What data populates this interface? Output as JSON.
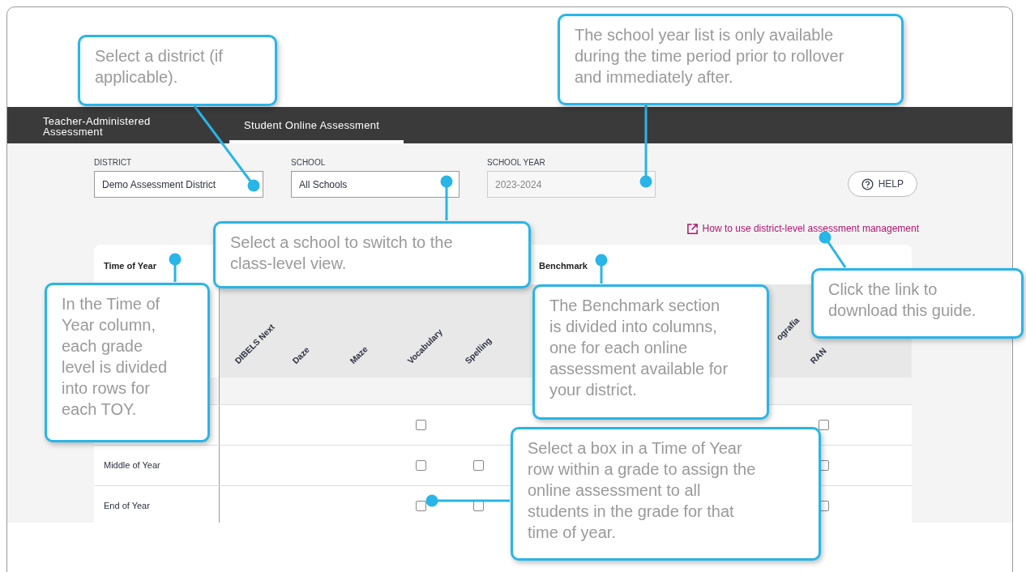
{
  "tabs": [
    {
      "label": "Teacher-Administered Assessment",
      "selected": false
    },
    {
      "label": "Student Online Assessment",
      "selected": true
    }
  ],
  "filters": [
    {
      "label": "DISTRICT",
      "value": "Demo Assessment District",
      "disabled": false
    },
    {
      "label": "SCHOOL",
      "value": "All Schools",
      "disabled": false
    },
    {
      "label": "SCHOOL YEAR",
      "value": "2023-2024",
      "disabled": true
    }
  ],
  "help_button": {
    "label": "HELP"
  },
  "guide_link": "How to use district-level assessment management",
  "table": {
    "time_heading": "Time of Year",
    "benchmark_heading": "Benchmark",
    "columns": [
      {
        "kind": "full",
        "label": "DIBELS Next"
      },
      {
        "kind": "full",
        "label": "Daze"
      },
      {
        "kind": "full",
        "label": "Maze"
      },
      {
        "kind": "full",
        "label": "Vocabulary"
      },
      {
        "kind": "full",
        "label": "Spelling"
      },
      {
        "kind": "covered"
      },
      {
        "kind": "covered"
      },
      {
        "kind": "covered"
      },
      {
        "kind": "covered"
      },
      {
        "kind": "cut",
        "label": "ografía"
      },
      {
        "kind": "full",
        "label": "RAN"
      }
    ],
    "rows": [
      {
        "kind": "grade",
        "cells": []
      },
      {
        "kind": "time",
        "cells": [
          {
            "kind": "blank"
          },
          {
            "kind": "blank"
          },
          {
            "kind": "blank"
          },
          {
            "kind": "checkbox",
            "checked": false
          },
          {
            "kind": "blank"
          },
          {
            "kind": "blank"
          },
          {
            "kind": "blank"
          },
          {
            "kind": "blank"
          },
          {
            "kind": "blank"
          },
          {
            "kind": "blank"
          },
          {
            "kind": "checkbox",
            "checked": false
          }
        ]
      },
      {
        "kind": "time",
        "label": "Middle of Year",
        "cells": [
          {
            "kind": "blank"
          },
          {
            "kind": "blank"
          },
          {
            "kind": "blank"
          },
          {
            "kind": "checkbox",
            "checked": false
          },
          {
            "kind": "checkbox",
            "checked": false
          },
          {
            "kind": "blank"
          },
          {
            "kind": "blank"
          },
          {
            "kind": "blank"
          },
          {
            "kind": "blank"
          },
          {
            "kind": "blank"
          },
          {
            "kind": "checkbox",
            "checked": false
          }
        ]
      },
      {
        "kind": "time",
        "label": "End of Year",
        "cells": [
          {
            "kind": "blank"
          },
          {
            "kind": "blank"
          },
          {
            "kind": "blank"
          },
          {
            "kind": "checkbox",
            "checked": false
          },
          {
            "kind": "checkbox",
            "checked": false
          },
          {
            "kind": "blank"
          },
          {
            "kind": "blank"
          },
          {
            "kind": "blank"
          },
          {
            "kind": "blank"
          },
          {
            "kind": "blank"
          },
          {
            "kind": "checkbox",
            "checked": false
          }
        ]
      }
    ]
  },
  "callouts": [
    {
      "text": "Select a district (if applicable)."
    },
    {
      "text": "The school year list is only available during the time period prior to rollover and immediately after."
    },
    {
      "text": "Select a school to switch to the class-level view."
    },
    {
      "text": "In the Time of Year column, each grade level is divided into rows for each TOY."
    },
    {
      "text": "The Benchmark section is divided into columns, one for each online assessment available for your district."
    },
    {
      "text": "Click the link to download this guide."
    },
    {
      "text": "Select a box in a Time of Year row within a grade to assign the online assessment to all students in the grade for that time of year."
    }
  ]
}
